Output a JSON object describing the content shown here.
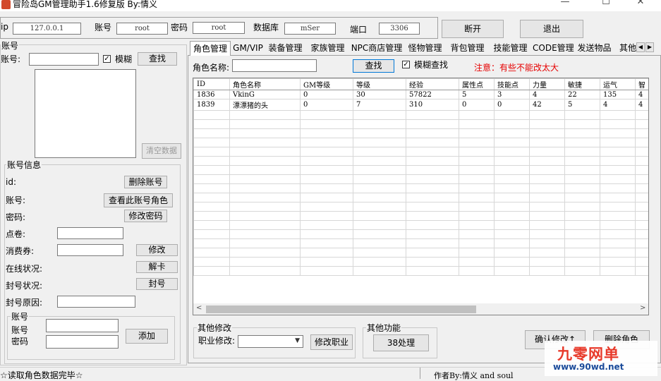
{
  "window": {
    "title": "冒险岛GM管理助手1.6修复版 By:情义",
    "min": "—",
    "max": "☐",
    "close": "✕"
  },
  "conn": {
    "ip_label": "ip",
    "ip": "127.0.0.1",
    "account_label": "账号",
    "account": "root",
    "password_label": "密码",
    "password": "root",
    "db_label": "数据库",
    "db": "mSer",
    "port_label": "端口",
    "port": "3306",
    "disconnect": "断开",
    "exit": "退出"
  },
  "left": {
    "account_group": "账号",
    "account_label": "账号:",
    "fuzzy": "模糊",
    "search": "查找",
    "clear": "清空数据",
    "info_group": "账号信息",
    "id_label": "id:",
    "delete_account": "删除账号",
    "acc_label": "账号:",
    "view_roles": "查看此账号角色",
    "pwd_label": "密码:",
    "change_pwd": "修改密码",
    "points_label": "点卷:",
    "voucher_label": "消费券:",
    "modify": "修改",
    "online_label": "在线状况:",
    "unlock": "解卡",
    "ban_label": "封号状况:",
    "ban": "封号",
    "ban_reason_label": "封号原因:",
    "new_group": "账号",
    "new_account_label": "账号",
    "new_password_label": "密码",
    "add": "添加"
  },
  "tabs": [
    "角色管理",
    "GM/VIP",
    "装备管理",
    "家族管理",
    "NPC商店管理",
    "怪物管理",
    "背包管理",
    "技能管理",
    "CODE管理",
    "发送物品",
    "其他"
  ],
  "role": {
    "name_label": "角色名称:",
    "search": "查找",
    "fuzzy": "模糊查找",
    "note": "注意：有些不能改太大"
  },
  "table": {
    "columns": [
      "ID",
      "角色名称",
      "GM等级",
      "等级",
      "经验",
      "属性点",
      "技能点",
      "力量",
      "敏捷",
      "运气",
      "智"
    ],
    "rows": [
      [
        "1836",
        "VkinG",
        "0",
        "30",
        "57822",
        "5",
        "3",
        "4",
        "22",
        "135",
        "4"
      ],
      [
        "1839",
        "漂漂猪的头",
        "0",
        "7",
        "310",
        "0",
        "0",
        "42",
        "5",
        "4",
        "4"
      ]
    ]
  },
  "bottom": {
    "other_modify": "其他修改",
    "job_label": "职业修改:",
    "change_job": "修改职业",
    "other_func": "其他功能",
    "btn38": "38处理",
    "confirm": "确认修改↑",
    "delete_role": "删除角色"
  },
  "status": {
    "left": "☆读取角色数据完毕☆",
    "right": "作者By:情义 and soul"
  },
  "watermark": {
    "name": "九零网单",
    "url": "www.90wd.net"
  }
}
